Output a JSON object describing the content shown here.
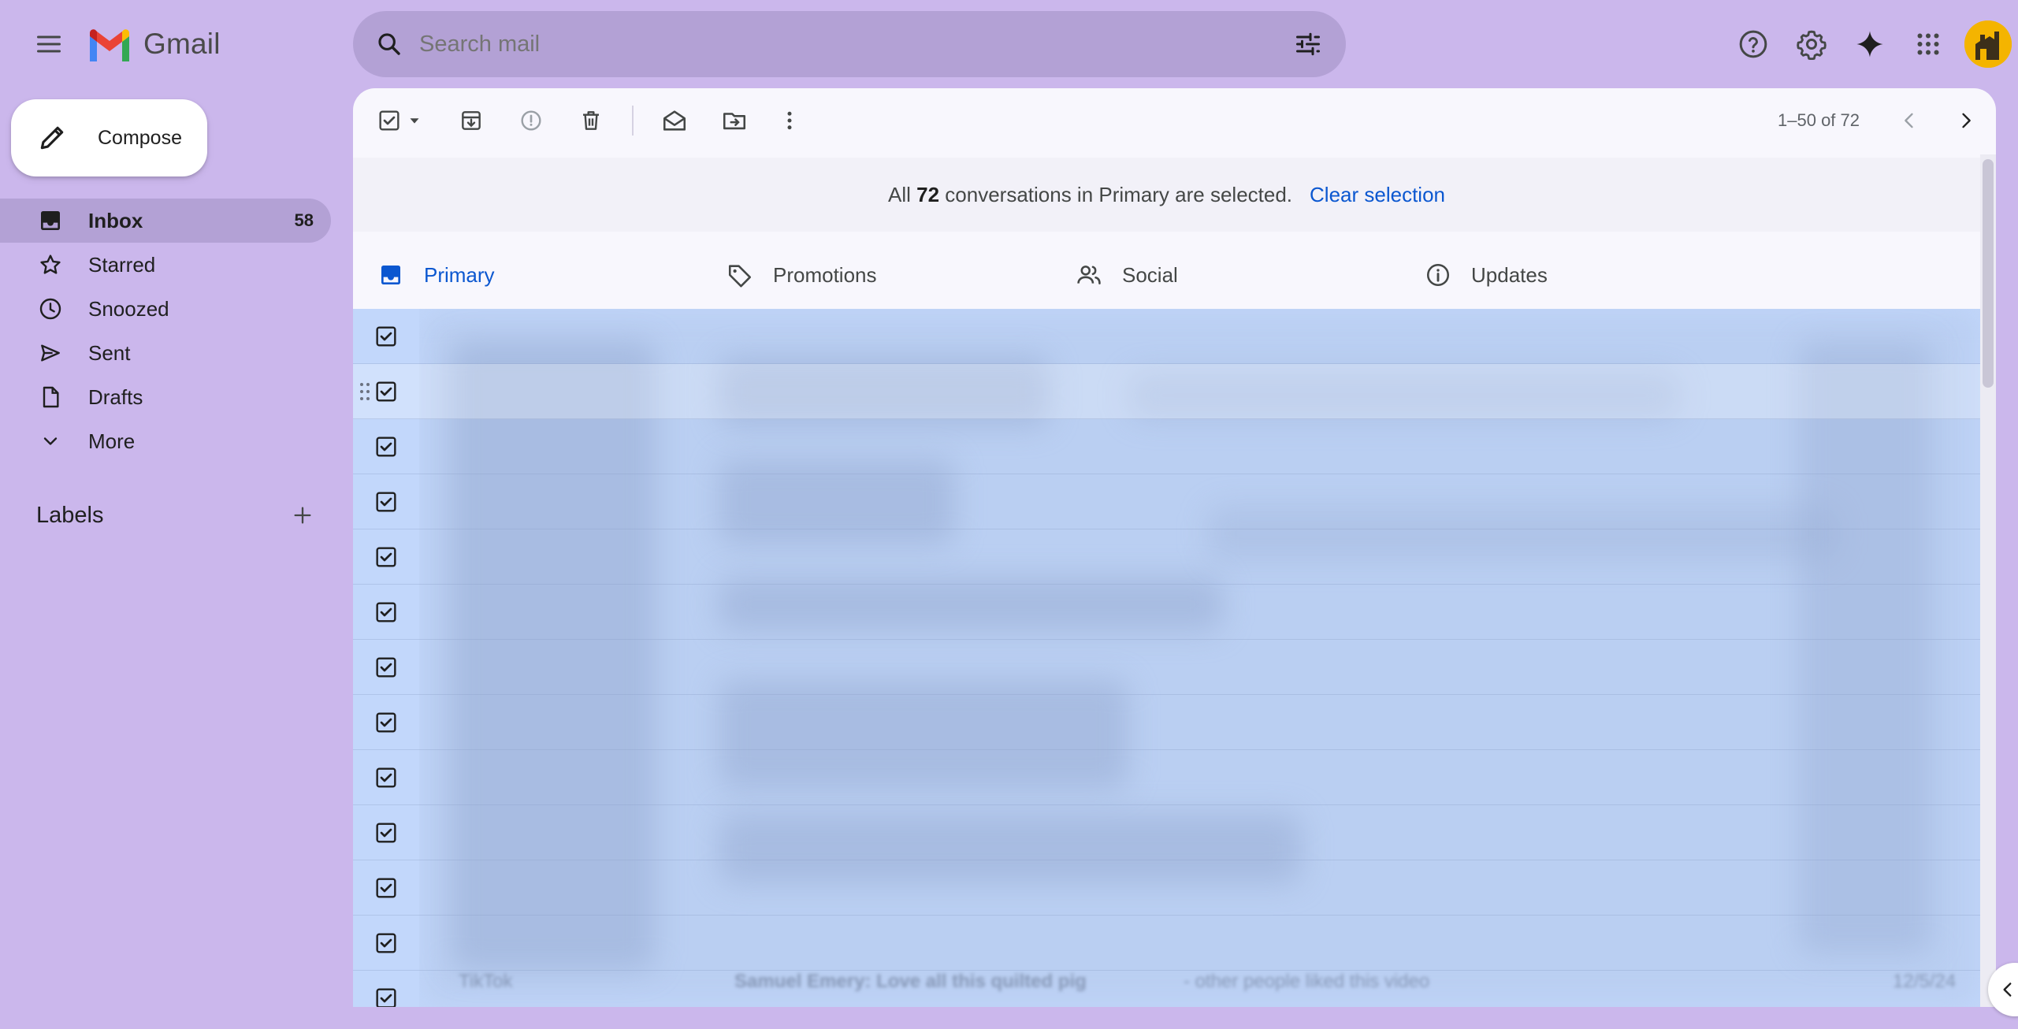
{
  "app": {
    "logo_text": "Gmail"
  },
  "search": {
    "placeholder": "Search mail"
  },
  "compose": {
    "label": "Compose"
  },
  "sidebar": {
    "items": [
      {
        "label": "Inbox",
        "count": "58",
        "icon": "inbox-icon",
        "active": true
      },
      {
        "label": "Starred",
        "count": "",
        "icon": "star-icon"
      },
      {
        "label": "Snoozed",
        "count": "",
        "icon": "clock-icon"
      },
      {
        "label": "Sent",
        "count": "",
        "icon": "send-icon"
      },
      {
        "label": "Drafts",
        "count": "",
        "icon": "draft-icon"
      },
      {
        "label": "More",
        "count": "",
        "icon": "chevron-down-icon"
      }
    ],
    "labels_title": "Labels"
  },
  "toolbar": {
    "pager": "1–50 of 72"
  },
  "banner": {
    "prefix": "All",
    "count": "72",
    "suffix": "conversations in Primary are selected.",
    "clear_link": "Clear selection"
  },
  "tabs": [
    {
      "label": "Primary",
      "icon": "inbox-tab-icon",
      "active": true
    },
    {
      "label": "Promotions",
      "icon": "tag-icon"
    },
    {
      "label": "Social",
      "icon": "people-icon"
    },
    {
      "label": "Updates",
      "icon": "info-icon"
    }
  ],
  "list": {
    "row_count": 13,
    "all_selected": true,
    "last_row": {
      "sender": "TikTok",
      "subject": "Samuel Emery: Love all this quilted pig",
      "snippet": "- other people liked this video",
      "date": "12/5/24"
    }
  },
  "colors": {
    "background": "#cbb7ec",
    "search_bg": "#b3a1d5",
    "accent": "#0b57d0",
    "selected_row": "#c2d7fb"
  }
}
